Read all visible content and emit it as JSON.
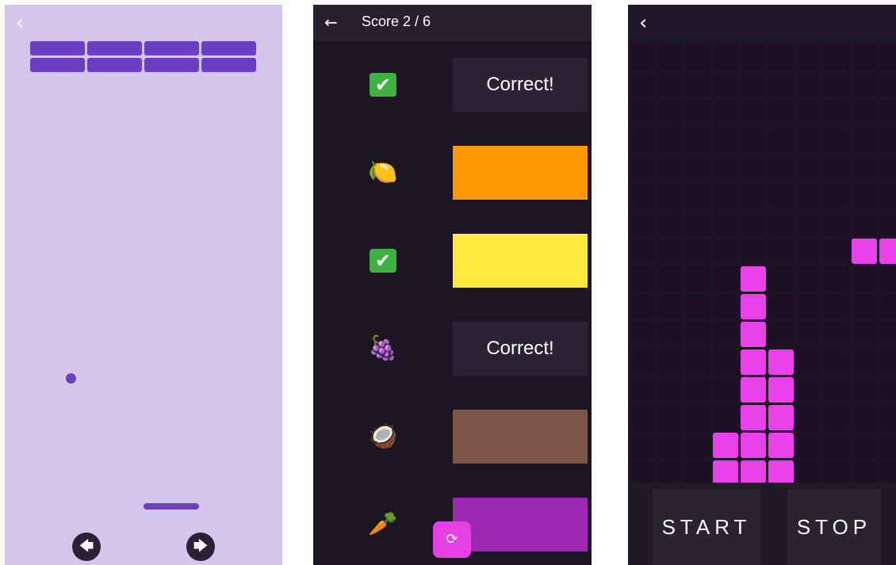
{
  "breakout": {
    "back_icon": "chevron-left-icon",
    "left_button_icon": "arrow-left-icon",
    "right_button_icon": "arrow-right-icon",
    "brick_rows": 2,
    "brick_cols": 4,
    "colors": {
      "background": "#d3c6ea",
      "brick": "#6a3fc2",
      "button": "#2a2233"
    }
  },
  "quiz": {
    "back_icon": "arrow-left-icon",
    "score_label": "Score 2 / 6",
    "rows": [
      {
        "icon": "check-icon",
        "glyph": "✔",
        "slot_text": "Correct!",
        "slot_color": "#2a2333"
      },
      {
        "icon": "lemon-icon",
        "glyph": "🍋",
        "slot_text": "",
        "slot_color": "#ff9800"
      },
      {
        "icon": "check-icon",
        "glyph": "✔",
        "slot_text": "",
        "slot_color": "#ffeb3b"
      },
      {
        "icon": "grapes-icon",
        "glyph": "🍇",
        "slot_text": "Correct!",
        "slot_color": "#2a2333"
      },
      {
        "icon": "coconut-icon",
        "glyph": "🥥",
        "slot_text": "",
        "slot_color": "#795548"
      },
      {
        "icon": "carrot-icon",
        "glyph": "🥕",
        "slot_text": "",
        "slot_color": "#9c27b0"
      }
    ],
    "reset_icon": "refresh-icon",
    "colors": {
      "background": "#1c1524",
      "header": "#27202f",
      "accent": "#e73fe6"
    }
  },
  "blocks": {
    "back_icon": "chevron-left-icon",
    "columns": 10,
    "rows": 16,
    "filled_cells": [
      [
        8,
        7
      ],
      [
        9,
        7
      ],
      [
        4,
        8
      ],
      [
        4,
        9
      ],
      [
        4,
        10
      ],
      [
        4,
        11
      ],
      [
        5,
        11
      ],
      [
        4,
        12
      ],
      [
        5,
        12
      ],
      [
        4,
        13
      ],
      [
        5,
        13
      ],
      [
        3,
        14
      ],
      [
        4,
        14
      ],
      [
        5,
        14
      ],
      [
        3,
        15
      ],
      [
        4,
        15
      ],
      [
        5,
        15
      ]
    ],
    "start_label": "START",
    "stop_label": "STOP",
    "colors": {
      "background": "#1c1525",
      "cell": "#1f0f24",
      "block": "#ea40ea"
    }
  }
}
